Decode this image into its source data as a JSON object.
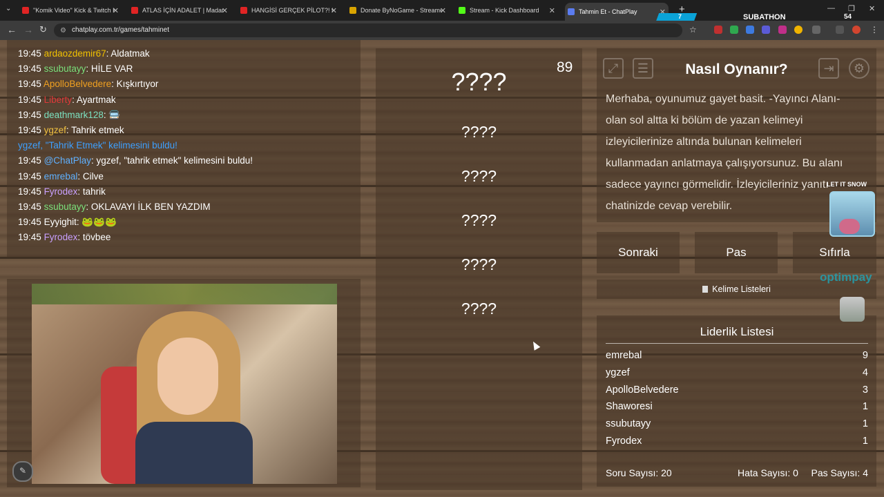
{
  "browser": {
    "tabs": [
      {
        "title": "\"Komik Video\" Kick & Twitch K",
        "icon_color": "#e02424"
      },
      {
        "title": "ATLAS İÇİN ADALET | Madara C",
        "icon_color": "#e02424"
      },
      {
        "title": "HANGİSİ GERÇEK PİLOT?! ft. @",
        "icon_color": "#e02424"
      },
      {
        "title": "Donate ByNoGame - Streamer",
        "icon_color": "#d9a400"
      },
      {
        "title": "Stream - Kick Dashboard",
        "icon_color": "#53fc18"
      },
      {
        "title": "Tahmin Et - ChatPlay",
        "icon_color": "#5b7cf0"
      }
    ],
    "url": "chatplay.com.tr/games/tahminet",
    "new_tab": "+"
  },
  "subathon": {
    "left_count": "7",
    "label": "SUBATHON",
    "right_count": "54"
  },
  "chat": [
    {
      "time": "19:45",
      "user": "ardaozdemir67",
      "user_color": "#f0c000",
      "text": ": Aldatmak"
    },
    {
      "time": "19:45",
      "user": "ssubutayy",
      "user_color": "#7be07b",
      "text": ": HİLE VAR"
    },
    {
      "time": "19:45",
      "user": "ApolloBelvedere",
      "user_color": "#f0a020",
      "text": ": Kışkırtıyor"
    },
    {
      "time": "19:45",
      "user": "Liberty",
      "user_color": "#e03a3a",
      "text": ": Ayartmak"
    },
    {
      "time": "19:45",
      "user": "deathmark128",
      "user_color": "#7be0c0",
      "text": ": 🚍"
    },
    {
      "time": "19:45",
      "user": "ygzef",
      "user_color": "#f0c040",
      "text": ": Tahrik etmek"
    },
    {
      "time": "",
      "user": "ygzef, \"Tahrik Etmek\" kelimesini buldu!",
      "user_color": "#3ea0ff",
      "text": ""
    },
    {
      "time": "19:45",
      "user": "@ChatPlay",
      "user_color": "#5fb0ff",
      "text": ": ygzef, \"tahrik etmek\" kelimesini buldu!"
    },
    {
      "time": "19:45",
      "user": "emrebal",
      "user_color": "#5fb0ff",
      "text": ": Cilve"
    },
    {
      "time": "19:45",
      "user": "Fyrodex",
      "user_color": "#c9a0ff",
      "text": ": tahrik"
    },
    {
      "time": "19:45",
      "user": "ssubutayy",
      "user_color": "#7be07b",
      "text": ": OKLAVAYI İLK BEN YAZDIM"
    },
    {
      "time": "19:45",
      "user": "Eyyighit",
      "user_color": "#ffffff",
      "text": ": 🐸🐸🐸"
    },
    {
      "time": "19:45",
      "user": "Fyrodex",
      "user_color": "#c9a0ff",
      "text": ": tövbee"
    }
  ],
  "game": {
    "main_word": "????",
    "hidden_words": [
      "????",
      "????",
      "????",
      "????",
      "????"
    ],
    "timer": "89"
  },
  "info": {
    "title": "Nasıl Oynanır?",
    "text": "Merhaba, oyunumuz gayet basit. -Yayıncı Alanı- olan sol altta ki bölüm de yazan kelimeyi izleyicilerinize altında bulunan kelimeleri kullanmadan anlatmaya çalışıyorsunuz. Bu alanı sadece yayıncı görmelidir. İzleyicileriniz yanıtı chatinizde cevap verebilir."
  },
  "controls": {
    "next": "Sonraki",
    "pass": "Pas",
    "reset": "Sıfırla"
  },
  "word_lists": "Kelime Listeleri",
  "leaderboard": {
    "title": "Liderlik Listesi",
    "rows": [
      {
        "name": "emrebal",
        "score": "9"
      },
      {
        "name": "ygzef",
        "score": "4"
      },
      {
        "name": "ApolloBelvedere",
        "score": "3"
      },
      {
        "name": "Shaworesi",
        "score": "1"
      },
      {
        "name": "ssubutayy",
        "score": "1"
      },
      {
        "name": "Fyrodex",
        "score": "1"
      }
    ]
  },
  "stats": {
    "questions": "Soru Sayısı: 20",
    "errors": "Hata Sayısı: 0",
    "passes": "Pas Sayısı: 4"
  },
  "overlay": {
    "snow_caption": "LET IT SNOW",
    "brand": "optimpay"
  }
}
